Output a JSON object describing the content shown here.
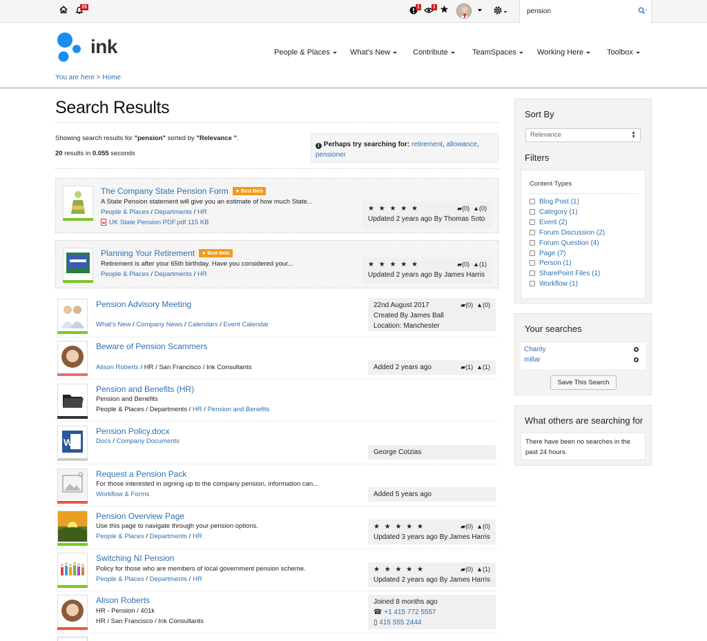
{
  "topbar": {
    "notif_count": "15",
    "alert_count": "1",
    "watch_count": "1",
    "search_value": "pension"
  },
  "header": {
    "logo_text": "ink",
    "nav": [
      "People & Places",
      "What's New",
      "Contribute",
      "TeamSpaces",
      "Working Here",
      "Toolbox"
    ],
    "breadcrumb_prefix": "You are here >",
    "breadcrumb_home": "Home"
  },
  "page": {
    "title": "Search Results",
    "showing_prefix": "Showing search results for ",
    "query": "\"pension\"",
    "sorted_by": " sorted by ",
    "sort_value": "\"Relevance \"",
    "period": ".",
    "results_count": "20",
    "results_in": " results in ",
    "seconds_value": "0.055",
    "seconds_label": " seconds",
    "suggest_label": "Perhaps try searching for:",
    "suggest_terms": [
      "retirement",
      "allowance",
      "pensioner"
    ]
  },
  "best_bets": [
    {
      "title": "The Company State Pension Form",
      "badge": "★ Best Bets",
      "summary": "A State Pension statement will give you an estimate of how much State...",
      "path": [
        "People & Places",
        "Departments",
        "HR"
      ],
      "attachment": "UK State Pension PDF.pdf 115 KB",
      "stars": "★ ★ ★ ★ ★",
      "comments": "(0)",
      "likes": "(0)",
      "updated": "Updated 2 years ago By Thomas Soto"
    },
    {
      "title": "Planning Your Retirement",
      "badge": "★ Best Bets",
      "summary": "Retirement is after your 65th birthday. Have you considered your...",
      "path": [
        "People & Places",
        "Departments",
        "HR"
      ],
      "stars": "★ ★ ★ ★ ★",
      "comments": "(0)",
      "likes": "(1)",
      "updated": "Updated 2 years ago By James Harris"
    }
  ],
  "results": [
    {
      "title": "Pension Advisory Meeting",
      "path": [
        "What's New",
        "Company News",
        "Calendars",
        "Event Calendar"
      ],
      "meta": [
        "22nd August 2017",
        "Created By James Ball",
        "Location: Manchester"
      ],
      "comments": "(0)",
      "likes": "(0)"
    },
    {
      "title": "Beware of Pension Scammers",
      "path_link": "Alison Roberts",
      "path_rest": " / HR / San Francisco / Ink Consultants",
      "meta": [
        "Added 2 years ago"
      ],
      "comments": "(1)",
      "likes": "(1)"
    },
    {
      "title": "Pension and Benefits (HR)",
      "summary": "Pension and Benefits",
      "path_plain": "People & Places / Departments / ",
      "path_links": [
        "HR",
        "Pension and Benefits"
      ]
    },
    {
      "title": "Pension Policy.docx",
      "path": [
        "Docs",
        "Company Documents"
      ],
      "meta": [
        "George Cotzias"
      ]
    },
    {
      "title": "Request a Pension Pack",
      "summary": "For those interested in signing up to the company pension, information can...",
      "path": [
        "Workflow & Forms"
      ],
      "meta": [
        "Added 5 years ago"
      ]
    },
    {
      "title": "Pension Overview Page",
      "summary": "Use this page to navigate through your pension options.",
      "path": [
        "People & Places",
        "Departments",
        "HR"
      ],
      "stars": "★ ★ ★ ★ ★",
      "comments": "(0)",
      "likes": "(0)",
      "meta": [
        "Updated 3 years ago By James Harris"
      ]
    },
    {
      "title": "Switching NI Pension",
      "summary": "Policy for those who are members of local government pension scheme.",
      "path": [
        "People & Places",
        "Departments",
        "HR"
      ],
      "stars": "★ ★ ★ ★ ★",
      "comments": "(0)",
      "likes": "(1)",
      "meta": [
        "Updated 2 years ago By James Harris"
      ]
    },
    {
      "title": "Alison Roberts",
      "summary": "HR - Pension / 401k",
      "path_text": "HR / San Francisco / Ink Consultants",
      "meta": [
        "Joined 8 months ago"
      ],
      "phone": "+1 415 772 5557",
      "mobile": "415 555 2444"
    }
  ],
  "sidebar": {
    "sort_title": "Sort By",
    "sort_value": "Relevance",
    "filters_title": "Filters",
    "content_types_label": "Content Types",
    "filters": [
      "Blog Post (1)",
      "Category (1)",
      "Event (2)",
      "Forum Discussion (2)",
      "Forum Question (4)",
      "Page (7)",
      "Person (1)",
      "SharePoint Files (1)",
      "Workflow (1)"
    ],
    "your_searches_title": "Your searches",
    "your_searches": [
      "Charity",
      "millar"
    ],
    "save_search_label": "Save This Search",
    "others_title": "What others are searching for",
    "others_text": "There have been no searches in the past 24 hours."
  },
  "colors": {
    "link": "#2f6fb0",
    "best_bets_badge": "#f39a1c",
    "bar_green": "#7cc623",
    "bar_red": "#e8706e",
    "bar_dark": "#333333",
    "bar_grey": "#cccccc",
    "bar_orange": "#e8583a",
    "notif_badge": "#c9191e",
    "logo_blue": "#1a8ef0"
  }
}
